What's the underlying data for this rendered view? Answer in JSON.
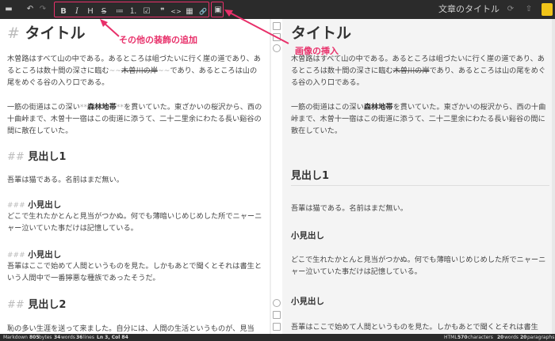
{
  "toolbar": {
    "document_title": "文章のタイトル",
    "format_buttons": [
      {
        "id": "bold",
        "glyph": "B"
      },
      {
        "id": "italic",
        "glyph": "I"
      },
      {
        "id": "heading",
        "glyph": "H"
      },
      {
        "id": "strikethrough",
        "glyph": "S"
      },
      {
        "id": "bulleted-list",
        "glyph": "≔"
      },
      {
        "id": "numbered-list",
        "glyph": "⒈"
      },
      {
        "id": "task-list",
        "glyph": "☑"
      },
      {
        "id": "quote",
        "glyph": "❞"
      },
      {
        "id": "code",
        "glyph": "<>"
      },
      {
        "id": "table",
        "glyph": "▦"
      },
      {
        "id": "link",
        "glyph": "🔗"
      }
    ],
    "image_glyph": "▣",
    "folder_glyph": "▬",
    "undo_glyph": "↶",
    "redo_glyph": "↷",
    "sync_glyph": "⟳",
    "upload_glyph": "⇧",
    "menu_glyph": "≡"
  },
  "annotations": {
    "decoration": "その他の装飾の追加",
    "image": "画像の挿入",
    "color": "#e8306a"
  },
  "editor": {
    "h1_hash": "#",
    "h1": "タイトル",
    "p1_a": "木曽路はすべて山の中である。あるところは岨づたいに行く崖の道であり、あるところは数十間の深さに臨む",
    "p1_strike_marks": "~~",
    "p1_strike": "木曽川の岸",
    "p1_b": "であり、あるところは山の尾をめぐる谷の入り口である。",
    "p2_a": "一筋の街道はこの深い",
    "p2_bold_marks": "**",
    "p2_bold": "森林地帯",
    "p2_b": "を貫いていた。東ざかいの桜沢から、西の十曲峠まで、木曽十一宿はこの街道に添うて、二十二里余にわたる長い谿谷の間に散在していた。",
    "h2a_hash": "##",
    "h2a": "見出し1",
    "p3": "吾輩は猫である。名前はまだ無い。",
    "h3a_hash": "###",
    "h3a": "小見出し",
    "p4": "どこで生れたかとんと見当がつかぬ。何でも薄暗いじめじめした所でニャーニャー泣いていた事だけは記憶している。",
    "h3b_hash": "###",
    "h3b": "小見出し",
    "p5": "吾輩はここで始めて人間というものを見た。しかもあとで聞くとそれは書生という人間中で一番獰悪な種族であったそうだ。",
    "h2b_hash": "##",
    "h2b": "見出し2",
    "p6": "恥の多い生涯を送って来ました。自分には、人間の生活というものが、見当"
  },
  "preview": {
    "h1": "タイトル",
    "p1_a": "木曽路はすべて山の中である。あるところは岨づたいに行く崖の道であり、あるところは数十間の深さに臨む",
    "p1_strike": "木曽川の岸",
    "p1_b": "であり、あるところは山の尾をめぐる谷の入り口である。",
    "p2_a": "一筋の街道はこの深い",
    "p2_bold": "森林地帯",
    "p2_b": "を貫いていた。東ざかいの桜沢から、西の十曲峠まで、木曽十一宿はこの街道に添うて、二十二里余にわたる長い谿谷の間に散在していた。",
    "h2a": "見出し1",
    "p3": "吾輩は猫である。名前はまだ無い。",
    "h3a": "小見出し",
    "p4": "どこで生れたかとんと見当がつかぬ。何でも薄暗いじめじめした所でニャーニャー泣いていた事だけは記憶している。",
    "h3b": "小見出し",
    "p5": "吾輩はここで始めて人間というものを見た。しかもあとで聞くとそれは書生"
  },
  "status": {
    "mode": "Markdown",
    "bytes": "805",
    "bytes_label": "bytes",
    "words": "34",
    "words_label": "words",
    "lines": "36",
    "lines_label": "lines",
    "position": "Ln 3, Col 84",
    "preview_mode": "HTML",
    "characters": "570",
    "characters_label": "characters",
    "pv_words": "20",
    "pv_words_label": "words",
    "paragraphs": "20",
    "paragraphs_label": "paragraphs"
  }
}
